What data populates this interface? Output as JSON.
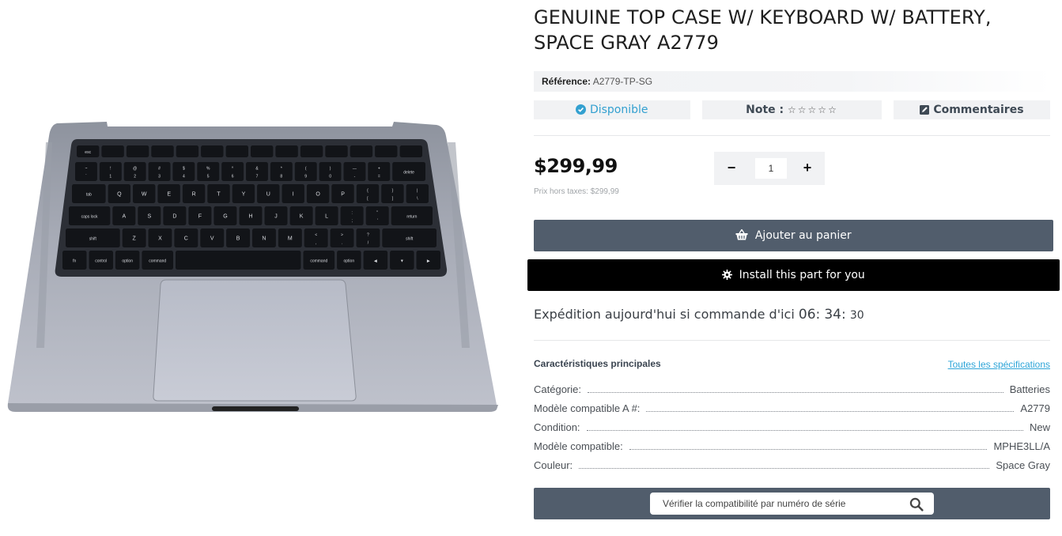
{
  "product": {
    "title": "GENUINE TOP CASE W/ KEYBOARD W/ BATTERY, SPACE GRAY A2779",
    "reference_label": "Référence:",
    "reference_value": "A2779-TP-SG",
    "availability": "Disponible",
    "note_label": "Note :",
    "stars": "☆☆☆☆☆",
    "comments": "Commentaires",
    "price": "$299,99",
    "price_tax": "Prix hors taxes: $299,99",
    "quantity": "1",
    "quantity_minus": "−",
    "quantity_plus": "+"
  },
  "actions": {
    "add_to_cart": "Ajouter au panier",
    "install": "Install this part for you"
  },
  "shipping": {
    "text": "Expédition aujourd'hui si commande d'ici",
    "hours": "06",
    "minutes": "34",
    "seconds": "30",
    "sep": ":"
  },
  "specs": {
    "title": "Caractéristiques principales",
    "link": "Toutes les spécifications",
    "rows": [
      {
        "label": "Catégorie:",
        "value": "Batteries"
      },
      {
        "label": "Modèle compatible A #:",
        "value": "A2779"
      },
      {
        "label": "Condition:",
        "value": "New"
      },
      {
        "label": "Modèle compatible:",
        "value": "MPHE3LL/A"
      },
      {
        "label": "Couleur:",
        "value": "Space Gray"
      }
    ]
  },
  "serial_check": {
    "placeholder": "Vérifier la compatibilité par numéro de série"
  },
  "keyboard": {
    "row_fn": [
      "esc",
      "",
      "",
      "",
      "",
      "",
      "",
      "",
      "",
      "",
      "",
      "",
      "",
      ""
    ],
    "row_num": [
      "~\n`",
      "!\n1",
      "@\n2",
      "#\n3",
      "$\n4",
      "%\n5",
      "^\n6",
      "&\n7",
      "*\n8",
      "(\n9",
      ")\n0",
      "—\n-",
      "+\n=",
      "delete"
    ],
    "row_q": [
      "tab",
      "Q",
      "W",
      "E",
      "R",
      "T",
      "Y",
      "U",
      "I",
      "O",
      "P",
      "{\n[",
      "}\n]",
      "|\n\\"
    ],
    "row_a": [
      "caps lock",
      "A",
      "S",
      "D",
      "F",
      "G",
      "H",
      "J",
      "K",
      "L",
      ":\n;",
      "\"\n'",
      "return"
    ],
    "row_z": [
      "shift",
      "Z",
      "X",
      "C",
      "V",
      "B",
      "N",
      "M",
      "<\n,",
      ">\n.",
      "?\n/",
      "shift"
    ],
    "row_bottom": [
      "fn",
      "control",
      "option",
      "command",
      "",
      "command",
      "option",
      "◀",
      "▼",
      "▶"
    ]
  },
  "colors": {
    "accent": "#33a0d0",
    "button_dark": "#515d6c",
    "button_black": "#000000",
    "pill_bg": "#f1f2f4"
  }
}
